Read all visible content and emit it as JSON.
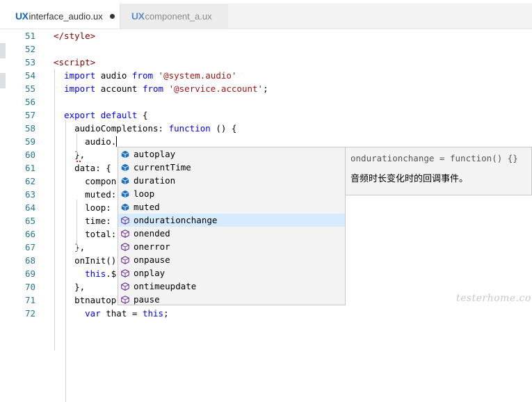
{
  "tabs": [
    {
      "badge": "UX",
      "name": "interface_audio.ux",
      "active": true,
      "dirty": true
    },
    {
      "badge": "UX",
      "name": "component_a.ux",
      "active": false,
      "dirty": false
    }
  ],
  "code_lines": [
    {
      "n": "51",
      "t": "</style>"
    },
    {
      "n": "52",
      "t": ""
    },
    {
      "n": "53",
      "t": "<script>"
    },
    {
      "n": "54",
      "t": "  import audio from '@system.audio'"
    },
    {
      "n": "55",
      "t": "  import account from '@service.account';"
    },
    {
      "n": "56",
      "t": ""
    },
    {
      "n": "57",
      "t": "  export default {"
    },
    {
      "n": "58",
      "t": "    audioCompletions: function () {"
    },
    {
      "n": "59",
      "t": "      audio."
    },
    {
      "n": "60",
      "t": "    },"
    },
    {
      "n": "61",
      "t": "    data: {"
    },
    {
      "n": "62",
      "t": "      compon"
    },
    {
      "n": "63",
      "t": "      muted:"
    },
    {
      "n": "64",
      "t": "      loop:"
    },
    {
      "n": "65",
      "t": "      time:"
    },
    {
      "n": "66",
      "t": "      total:"
    },
    {
      "n": "67",
      "t": "    },"
    },
    {
      "n": "68",
      "t": "    onInit()"
    },
    {
      "n": "69",
      "t": "      this.$"
    },
    {
      "n": "70",
      "t": "    },"
    },
    {
      "n": "71",
      "t": "    btnautop"
    },
    {
      "n": "72",
      "t": "      var that = this;"
    }
  ],
  "suggestions": [
    {
      "label": "autoplay",
      "kind": "property",
      "selected": false
    },
    {
      "label": "currentTime",
      "kind": "property",
      "selected": false
    },
    {
      "label": "duration",
      "kind": "property",
      "selected": false
    },
    {
      "label": "loop",
      "kind": "property",
      "selected": false
    },
    {
      "label": "muted",
      "kind": "property",
      "selected": false
    },
    {
      "label": "ondurationchange",
      "kind": "method",
      "selected": true
    },
    {
      "label": "onended",
      "kind": "method",
      "selected": false
    },
    {
      "label": "onerror",
      "kind": "method",
      "selected": false
    },
    {
      "label": "onpause",
      "kind": "method",
      "selected": false
    },
    {
      "label": "onplay",
      "kind": "method",
      "selected": false
    },
    {
      "label": "ontimeupdate",
      "kind": "method",
      "selected": false
    },
    {
      "label": "pause",
      "kind": "method",
      "selected": false
    }
  ],
  "detail": {
    "signature": "ondurationchange = function() {}",
    "doc": "音频时长变化时的回调事件。"
  },
  "watermark": "testerhome.com",
  "icons": {
    "property": "cube-filled-icon",
    "method": "cube-outline-icon"
  },
  "colors": {
    "accent": "#1565c0",
    "property_icon": "#1f6fbf",
    "method_icon": "#652d90",
    "selection": "#d6ebff",
    "line_number": "#237893"
  }
}
